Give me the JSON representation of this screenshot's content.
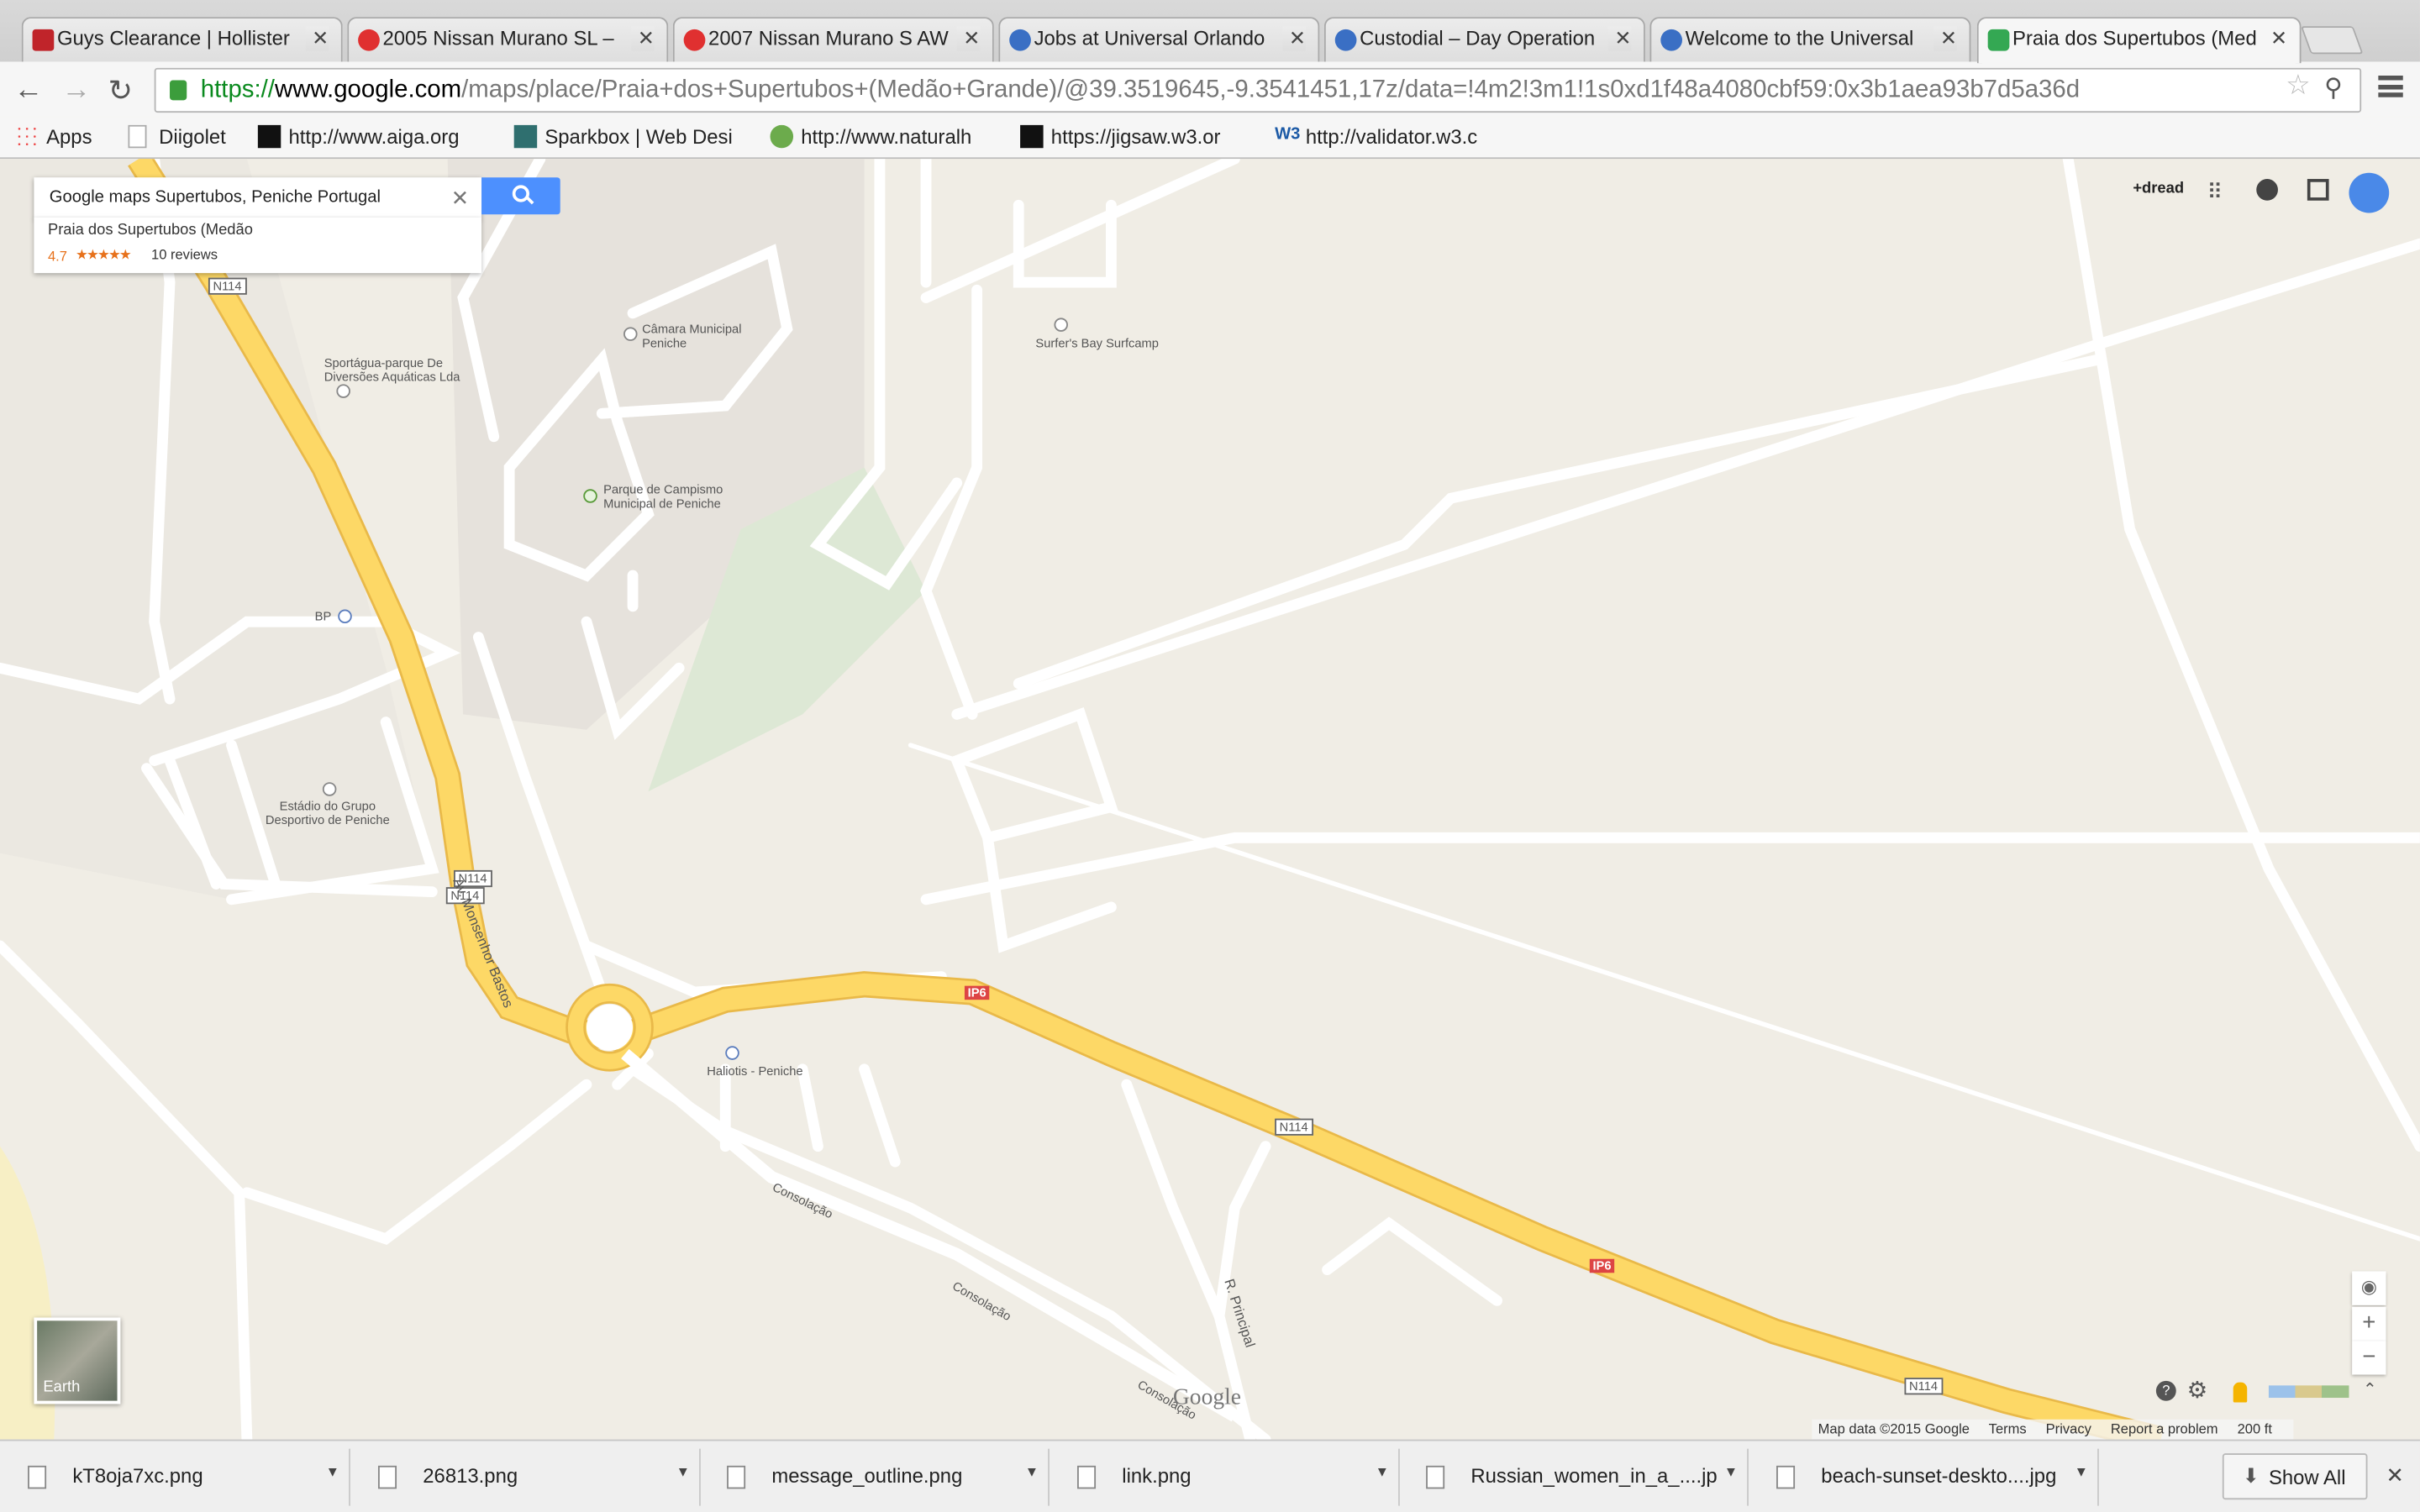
{
  "tabs": [
    {
      "title": "Guys Clearance | Hollister",
      "fav": "#c0242a",
      "icon": "hollister-icon"
    },
    {
      "title": "2005 Nissan Murano SL –",
      "fav": "#e03030",
      "icon": "cg-icon"
    },
    {
      "title": "2007 Nissan Murano S AW",
      "fav": "#e03030",
      "icon": "cg-icon"
    },
    {
      "title": "Jobs at Universal Orlando",
      "fav": "#3a6fc4",
      "icon": "globe-icon"
    },
    {
      "title": "Custodial – Day Operation",
      "fav": "#3a6fc4",
      "icon": "globe-icon"
    },
    {
      "title": "Welcome to the Universal",
      "fav": "#3a6fc4",
      "icon": "globe-icon"
    },
    {
      "title": "Praia dos Supertubos (Med",
      "fav": "#34a853",
      "icon": "google-maps-icon"
    }
  ],
  "address": {
    "protocol": "https://",
    "host": "www.google.com",
    "path": "/maps/place/Praia+dos+Supertubos+(Medão+Grande)/@39.3519645,-9.3541451,17z/data=!4m2!3m1!1s0xd1f48a4080cbf59:0x3b1aea93b7d5a36d"
  },
  "bookmarks": [
    {
      "label": "Apps",
      "icon": "apps-grid-icon"
    },
    {
      "label": "Diigolet",
      "icon": "page-icon"
    },
    {
      "label": "http://www.aiga.org",
      "icon": "aiga-icon"
    },
    {
      "label": "Sparkbox | Web Desi",
      "icon": "sparkbox-icon"
    },
    {
      "label": "http://www.naturalh",
      "icon": "leaf-icon"
    },
    {
      "label": "https://jigsaw.w3.or",
      "icon": "jigsaw-icon"
    },
    {
      "label": "http://validator.w3.c",
      "icon": "w3-icon"
    }
  ],
  "search": {
    "value": "Google maps  Supertubos, Peniche Portugal"
  },
  "place_card": {
    "name": "Praia dos Supertubos (Medão",
    "rating": "4.7",
    "stars": "★★★★★",
    "reviews": "10 reviews"
  },
  "google_bar": {
    "user": "+dread"
  },
  "map_labels": {
    "camara": "Câmara Municipal\nPeniche",
    "surfers": "Surfer's Bay Surfcamp",
    "sportagua": "Sportágua-parque De\nDiversões Aquáticas Lda",
    "parque": "Parque de Campismo\nMunicipal de Peniche",
    "bp": "BP",
    "estadio": "Estádio do Grupo\nDesportivo de Peniche",
    "haliotis": "Haliotis - Peniche",
    "av_monsenhor": "Av. Monsenhor Bastos",
    "r_principal": "R. Principal",
    "consolacao": "Consolação",
    "n114": "N114",
    "ip6": "IP6"
  },
  "earth_label": "Earth",
  "footer": {
    "data": "Map data ©2015 Google",
    "terms": "Terms",
    "privacy": "Privacy",
    "report": "Report a problem",
    "scale": "200 ft"
  },
  "google_logo": "Google",
  "downloads": [
    {
      "name": "kT8oja7xc.png"
    },
    {
      "name": "26813.png"
    },
    {
      "name": "message_outline.png"
    },
    {
      "name": "link.png"
    },
    {
      "name": "Russian_women_in_a_....jpg"
    },
    {
      "name": "beach-sunset-deskto....jpg"
    }
  ],
  "show_all": "Show All",
  "colors": {
    "highway": "#fdd866",
    "highway_edge": "#e9b949",
    "ip6_badge": "#d44"
  }
}
